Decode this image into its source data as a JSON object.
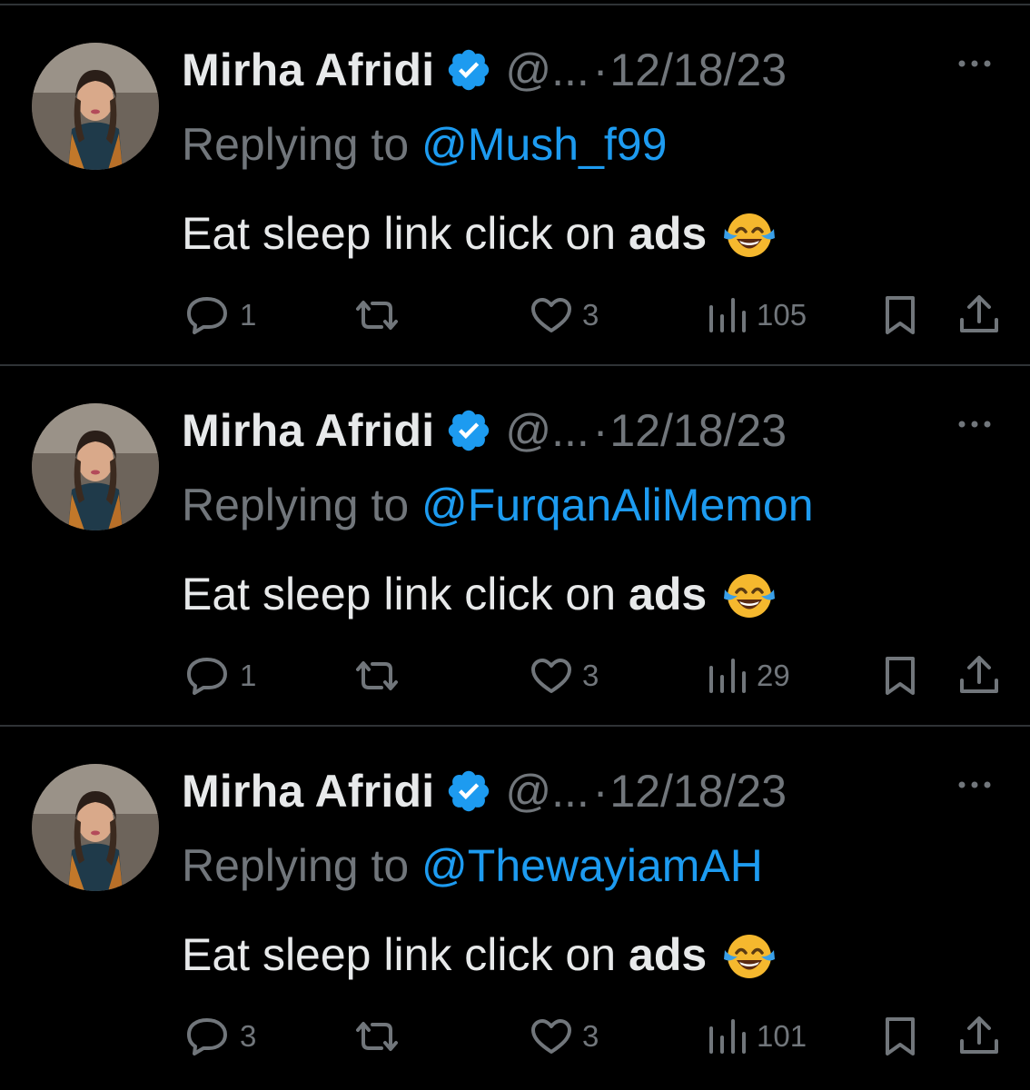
{
  "tweets": [
    {
      "author_name": "Mirha Afridi",
      "handle": "@...",
      "separator": "·",
      "date": "12/18/23",
      "replying_prefix": "Replying to ",
      "replying_to": "@Mush_f99",
      "text_plain": "Eat sleep link click on",
      "text_bold": "ads",
      "emoji": "face-with-tears-of-joy",
      "replies": "1",
      "likes": "3",
      "views": "105"
    },
    {
      "author_name": "Mirha Afridi",
      "handle": "@...",
      "separator": "·",
      "date": "12/18/23",
      "replying_prefix": "Replying to ",
      "replying_to": "@FurqanAliMemon",
      "text_plain": "Eat sleep link click on",
      "text_bold": "ads",
      "emoji": "face-with-tears-of-joy",
      "replies": "1",
      "likes": "3",
      "views": "29"
    },
    {
      "author_name": "Mirha Afridi",
      "handle": "@...",
      "separator": "·",
      "date": "12/18/23",
      "replying_prefix": "Replying to ",
      "replying_to": "@ThewayiamAH",
      "text_plain": "Eat sleep link click on",
      "text_bold": "ads",
      "emoji": "face-with-tears-of-joy",
      "replies": "3",
      "likes": "3",
      "views": "101"
    }
  ],
  "colors": {
    "background": "#000000",
    "text": "#e7e9ea",
    "muted": "#71767b",
    "accent": "#1d9bf0",
    "divider": "#2f3336"
  },
  "icons": {
    "verified": "verified-badge-icon",
    "more": "more-dots-icon",
    "reply": "reply-icon",
    "retweet": "retweet-icon",
    "like": "heart-icon",
    "views": "views-icon",
    "bookmark": "bookmark-icon",
    "share": "share-icon"
  }
}
